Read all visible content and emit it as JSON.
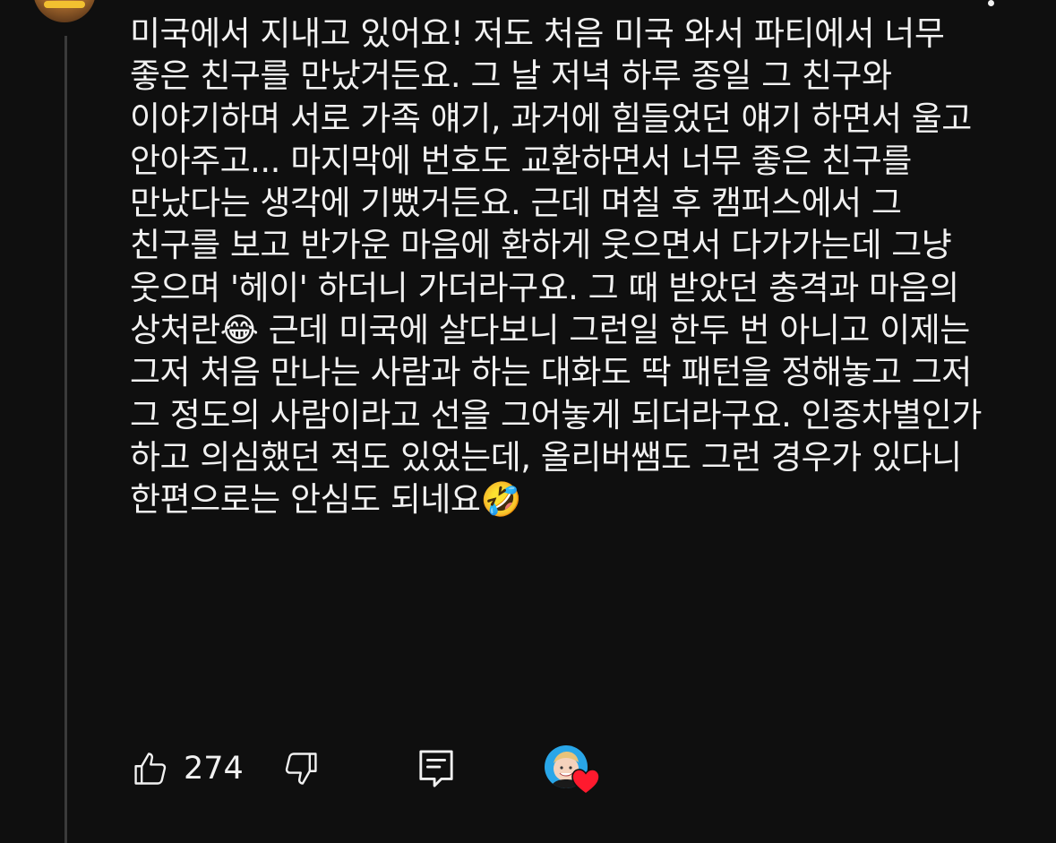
{
  "comment": {
    "text": "미국에서 지내고 있어요! 저도 처음 미국 와서 파티에서 너무 좋은 친구를 만났거든요. 그 날 저녁 하루 종일 그 친구와 이야기하며 서로 가족 얘기, 과거에 힘들었던 얘기 하면서 울고 안아주고... 마지막에 번호도 교환하면서 너무 좋은 친구를 만났다는 생각에 기뻤거든요. 근데 며칠 후 캠퍼스에서 그 친구를 보고 반가운 마음에 환하게 웃으면서 다가가는데 그냥 웃으며 '헤이' 하더니 가더라구요. 그 때 받았던 충격과 마음의 상처란😂 근데 미국에 살다보니 그런일 한두 번 아니고 이제는 그저 처음 만나는 사람과 하는 대화도 딱 패턴을 정해놓고 그저 그 정도의 사람이라고 선을 그어놓게 되더라구요. 인종차별인가 하고 의심했던 적도 있었는데, 올리버쌤도 그런 경우가 있다니 한편으로는 안심도 되네요🤣"
  },
  "actions": {
    "like_count": "274"
  },
  "icons": {
    "like": "thumbs-up-icon",
    "dislike": "thumbs-down-icon",
    "reply": "reply-comment-icon",
    "creator_heart": "heart-icon",
    "menu": "more-options-icon"
  },
  "colors": {
    "background": "#0f0f0f",
    "text": "#f1f1f1",
    "heart": "#ff1a2e",
    "thread_line": "#3a3a3a"
  }
}
